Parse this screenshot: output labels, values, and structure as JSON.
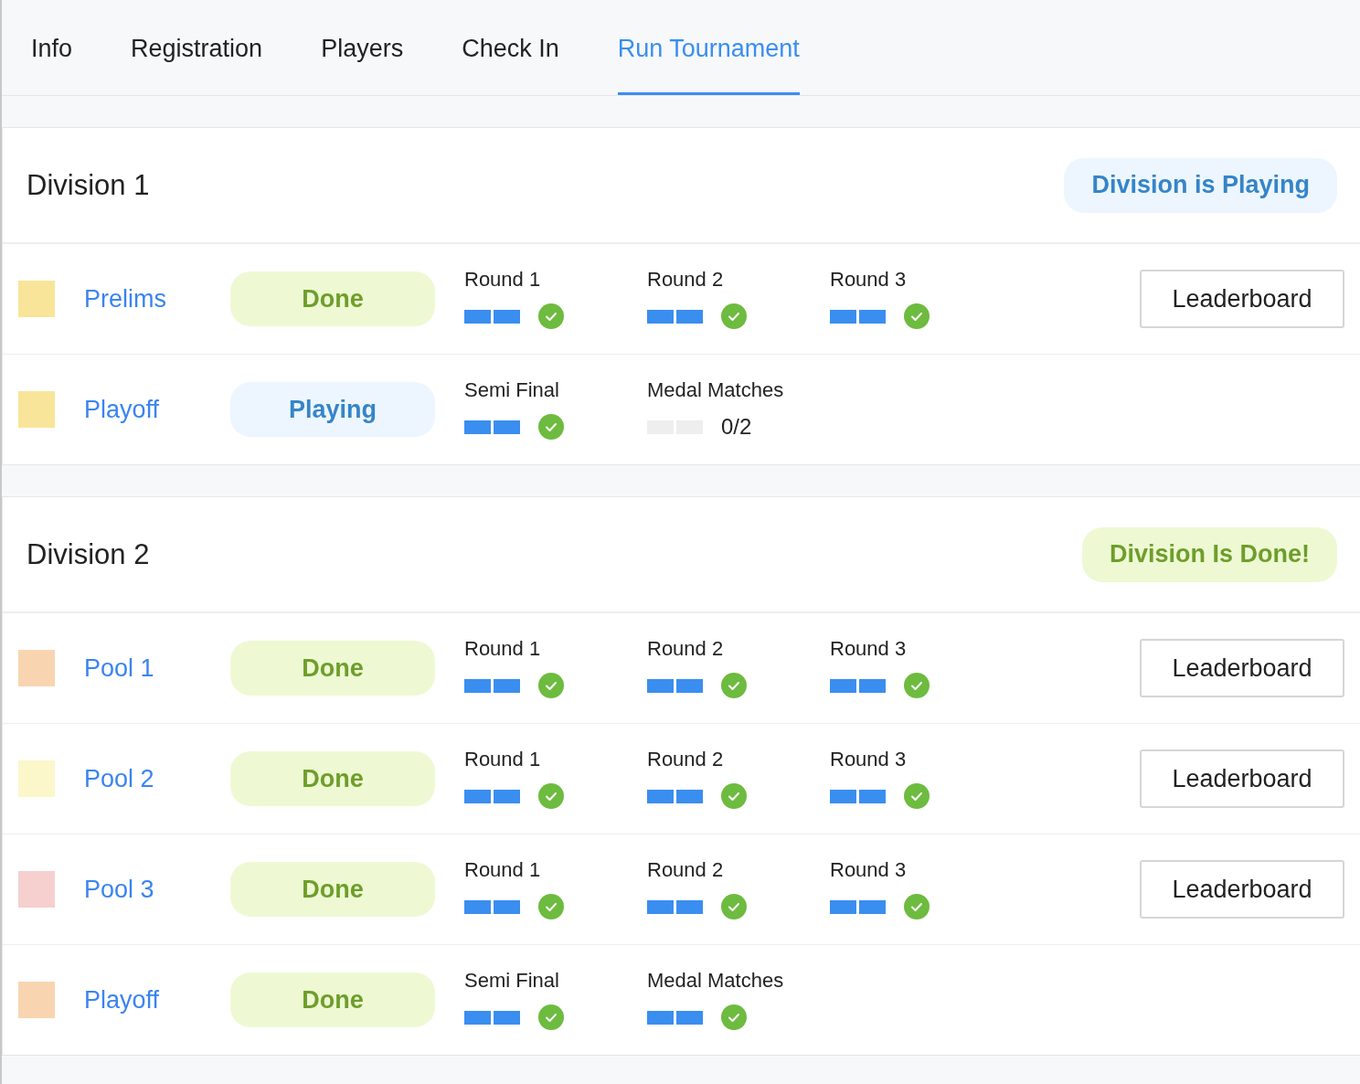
{
  "tabs": [
    {
      "label": "Info",
      "selected": false
    },
    {
      "label": "Registration",
      "selected": false
    },
    {
      "label": "Players",
      "selected": false
    },
    {
      "label": "Check In",
      "selected": false
    },
    {
      "label": "Run Tournament",
      "selected": true
    }
  ],
  "divisions": [
    {
      "title": "Division 1",
      "status": {
        "kind": "playing",
        "label": "Division is Playing"
      },
      "stages": [
        {
          "name": "Prelims",
          "color": "#f8e59a",
          "status": {
            "kind": "done",
            "label": "Done"
          },
          "rounds": [
            {
              "label": "Round 1",
              "kind": "complete",
              "games": [
                {
                  "played": true
                },
                {
                  "played": true
                }
              ]
            },
            {
              "label": "Round 2",
              "kind": "complete",
              "games": [
                {
                  "played": true
                },
                {
                  "played": true
                }
              ]
            },
            {
              "label": "Round 3",
              "kind": "complete",
              "games": [
                {
                  "played": true
                },
                {
                  "played": true
                }
              ]
            }
          ],
          "button": "Leaderboard"
        },
        {
          "name": "Playoff",
          "color": "#f8e59a",
          "status": {
            "kind": "playing",
            "label": "Playing"
          },
          "rounds": [
            {
              "label": "Semi Final",
              "kind": "complete",
              "games": [
                {
                  "played": true
                },
                {
                  "played": true
                }
              ]
            },
            {
              "label": "Medal Matches",
              "kind": "pending",
              "progress": "0/2",
              "games": [
                {
                  "played": false
                },
                {
                  "played": false
                }
              ]
            }
          ]
        }
      ]
    },
    {
      "title": "Division 2",
      "status": {
        "kind": "done",
        "label": "Division Is Done!"
      },
      "stages": [
        {
          "name": "Pool 1",
          "color": "#f8d5b0",
          "status": {
            "kind": "done",
            "label": "Done"
          },
          "rounds": [
            {
              "label": "Round 1",
              "kind": "complete",
              "games": [
                {
                  "played": true
                },
                {
                  "played": true
                }
              ]
            },
            {
              "label": "Round 2",
              "kind": "complete",
              "games": [
                {
                  "played": true
                },
                {
                  "played": true
                }
              ]
            },
            {
              "label": "Round 3",
              "kind": "complete",
              "games": [
                {
                  "played": true
                },
                {
                  "played": true
                }
              ]
            }
          ],
          "button": "Leaderboard"
        },
        {
          "name": "Pool 2",
          "color": "#fcf6cb",
          "status": {
            "kind": "done",
            "label": "Done"
          },
          "rounds": [
            {
              "label": "Round 1",
              "kind": "complete",
              "games": [
                {
                  "played": true
                },
                {
                  "played": true
                }
              ]
            },
            {
              "label": "Round 2",
              "kind": "complete",
              "games": [
                {
                  "played": true
                },
                {
                  "played": true
                }
              ]
            },
            {
              "label": "Round 3",
              "kind": "complete",
              "games": [
                {
                  "played": true
                },
                {
                  "played": true
                }
              ]
            }
          ],
          "button": "Leaderboard"
        },
        {
          "name": "Pool 3",
          "color": "#f6cfcf",
          "status": {
            "kind": "done",
            "label": "Done"
          },
          "rounds": [
            {
              "label": "Round 1",
              "kind": "complete",
              "games": [
                {
                  "played": true
                },
                {
                  "played": true
                }
              ]
            },
            {
              "label": "Round 2",
              "kind": "complete",
              "games": [
                {
                  "played": true
                },
                {
                  "played": true
                }
              ]
            },
            {
              "label": "Round 3",
              "kind": "complete",
              "games": [
                {
                  "played": true
                },
                {
                  "played": true
                }
              ]
            }
          ],
          "button": "Leaderboard"
        },
        {
          "name": "Playoff",
          "color": "#f8d5b0",
          "status": {
            "kind": "done",
            "label": "Done"
          },
          "rounds": [
            {
              "label": "Semi Final",
              "kind": "complete",
              "games": [
                {
                  "played": true
                },
                {
                  "played": true
                }
              ]
            },
            {
              "label": "Medal Matches",
              "kind": "complete",
              "games": [
                {
                  "played": true
                },
                {
                  "played": true
                }
              ]
            }
          ]
        }
      ]
    }
  ]
}
